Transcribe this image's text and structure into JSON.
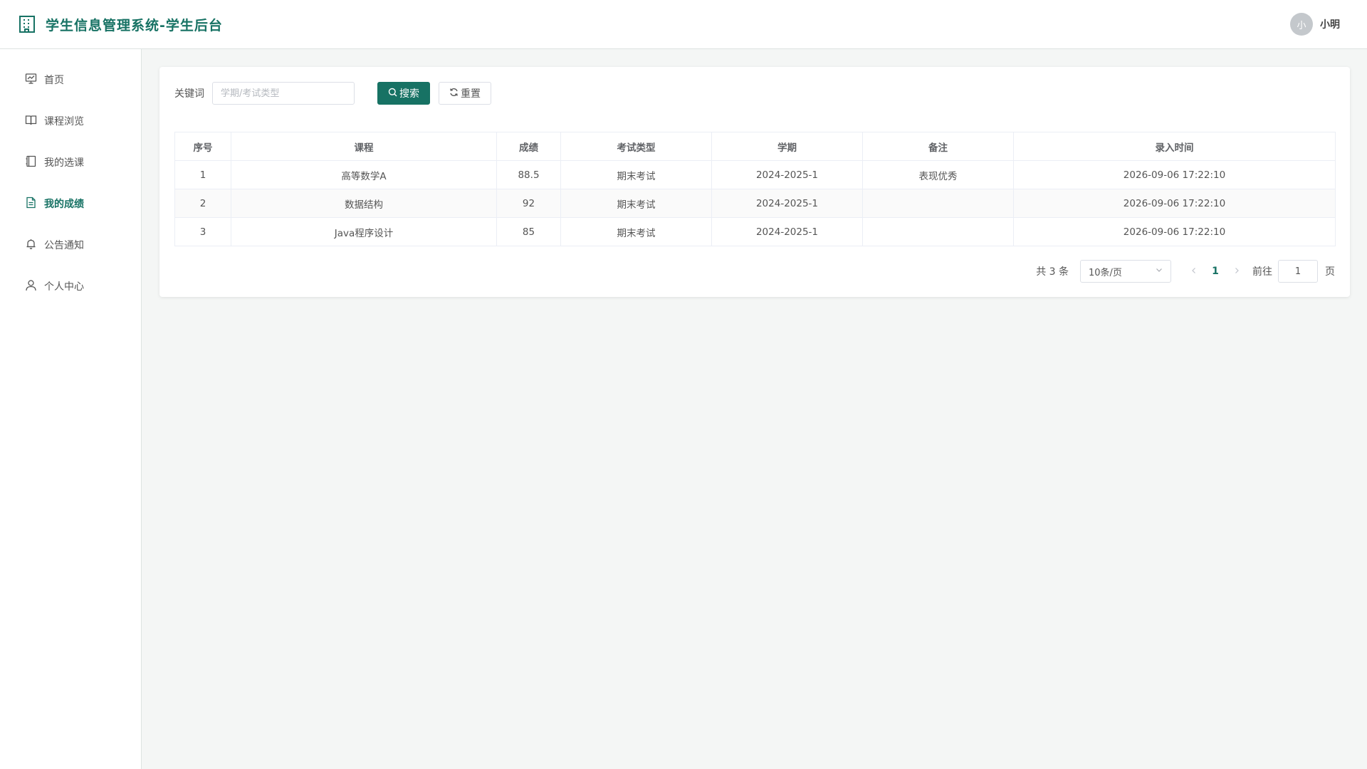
{
  "app": {
    "title": "学生信息管理系统-学生后台"
  },
  "user": {
    "avatar_text": "小",
    "name": "小明"
  },
  "sidebar": {
    "items": [
      {
        "label": "首页",
        "icon": "presentation-icon"
      },
      {
        "label": "课程浏览",
        "icon": "book-open-icon"
      },
      {
        "label": "我的选课",
        "icon": "notebook-icon"
      },
      {
        "label": "我的成绩",
        "icon": "document-icon",
        "active": true
      },
      {
        "label": "公告通知",
        "icon": "bell-icon"
      },
      {
        "label": "个人中心",
        "icon": "user-icon"
      }
    ]
  },
  "search": {
    "label": "关键词",
    "placeholder": "学期/考试类型",
    "value": "",
    "search_button": "搜索",
    "reset_button": "重置"
  },
  "table": {
    "headers": [
      "序号",
      "课程",
      "成绩",
      "考试类型",
      "学期",
      "备注",
      "录入时间"
    ],
    "rows": [
      [
        "1",
        "高等数学A",
        "88.5",
        "期末考试",
        "2024-2025-1",
        "表现优秀",
        "2026-09-06 17:22:10"
      ],
      [
        "2",
        "数据结构",
        "92",
        "期末考试",
        "2024-2025-1",
        "",
        "2026-09-06 17:22:10"
      ],
      [
        "3",
        "Java程序设计",
        "85",
        "期末考试",
        "2024-2025-1",
        "",
        "2026-09-06 17:22:10"
      ]
    ]
  },
  "pagination": {
    "total_text": "共 3 条",
    "page_size": "10条/页",
    "current_page": "1",
    "goto_label": "前往",
    "goto_value": "1",
    "page_suffix": "页"
  },
  "colors": {
    "accent": "#177264",
    "background": "#f4f6f5"
  }
}
